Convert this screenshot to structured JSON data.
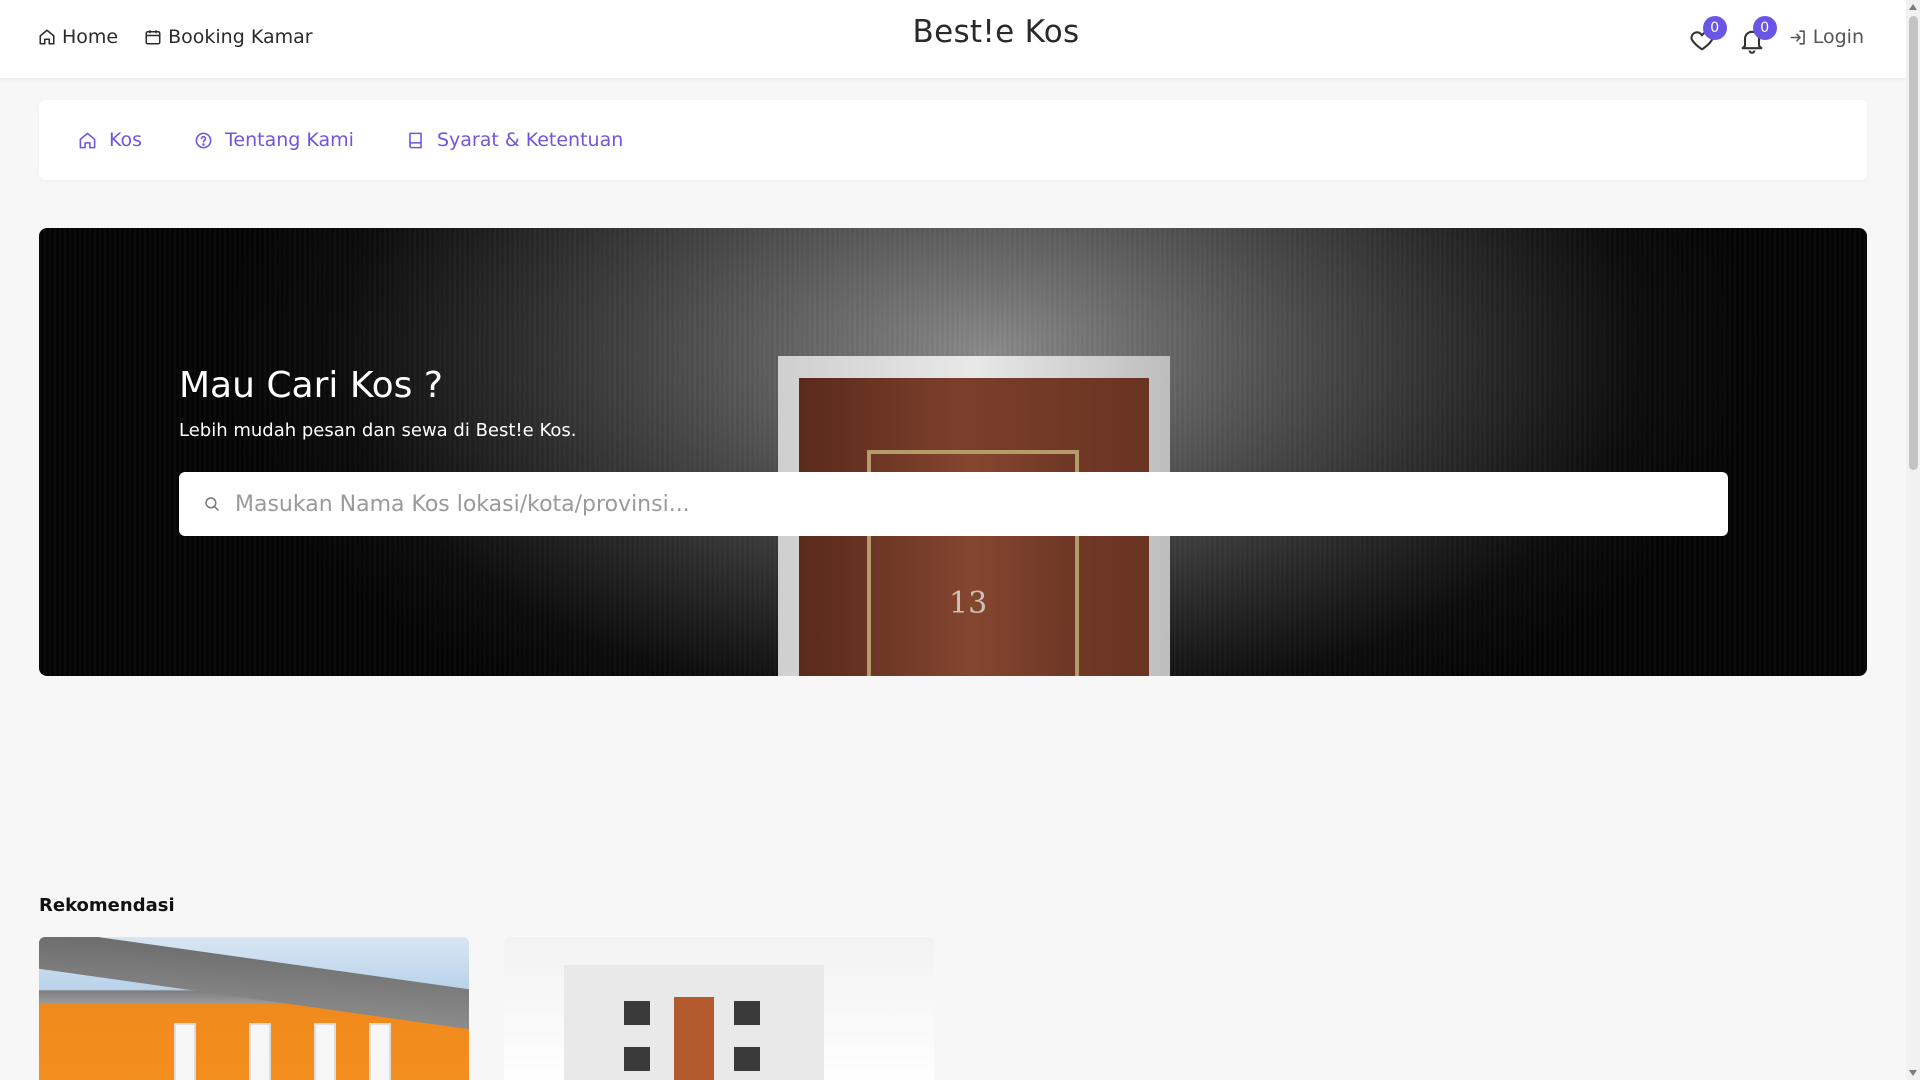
{
  "header": {
    "nav": [
      {
        "label": "Home",
        "icon": "home-icon"
      },
      {
        "label": "Booking Kamar",
        "icon": "calendar-icon"
      }
    ],
    "brand": "Best!e Kos",
    "wishlist_count": "0",
    "notification_count": "0",
    "login_label": "Login"
  },
  "subnav": [
    {
      "label": "Kos",
      "icon": "home-icon"
    },
    {
      "label": "Tentang Kami",
      "icon": "help-circle-icon"
    },
    {
      "label": "Syarat & Ketentuan",
      "icon": "book-icon"
    }
  ],
  "hero": {
    "title": "Mau Cari Kos ?",
    "subtitle": "Lebih mudah pesan dan sewa di Best!e Kos.",
    "door_number": "13",
    "search_placeholder": "Masukan Nama Kos lokasi/kota/provinsi..."
  },
  "recommendations": {
    "title": "Rekomendasi"
  },
  "colors": {
    "accent": "#6a56e6",
    "subnav_text": "#6f55e0"
  }
}
